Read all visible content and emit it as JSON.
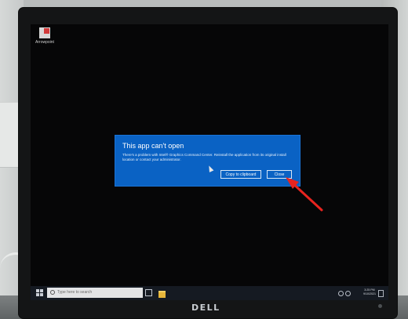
{
  "desktop": {
    "icon_label": "Arrowpoint"
  },
  "dialog": {
    "title": "This app can't open",
    "message": "There's a problem with Intel® Graphics Command Center. Reinstall the application from its original install location or contact your administrator.",
    "copy_button": "Copy to clipboard",
    "close_button": "Close",
    "background_color": "#0a62c4"
  },
  "taskbar": {
    "search_placeholder": "Type here to search",
    "clock_time": "3:25 PM",
    "clock_date": "9/10/2021"
  },
  "monitor": {
    "brand": "DELL"
  },
  "annotation": {
    "arrow_color": "#e8241f"
  }
}
